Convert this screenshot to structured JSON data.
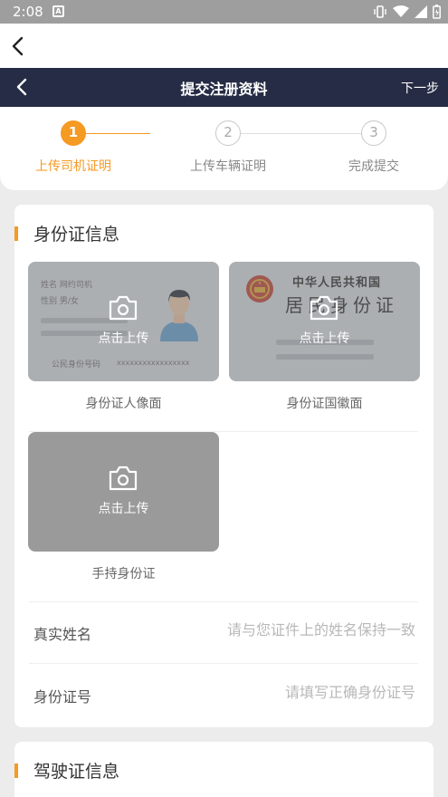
{
  "status_bar": {
    "time": "2:08",
    "notification_badge": "A"
  },
  "header": {
    "title": "提交注册资料",
    "next_label": "下一步"
  },
  "steps": [
    {
      "number": "1",
      "label": "上传司机证明"
    },
    {
      "number": "2",
      "label": "上传车辆证明"
    },
    {
      "number": "3",
      "label": "完成提交"
    }
  ],
  "id_section": {
    "title": "身份证信息",
    "upload_label": "点击上传",
    "front": {
      "caption": "身份证人像面",
      "name_line": "姓名  网约司机",
      "gender_line": "性别  男/女",
      "id_line": "公民身份号码",
      "id_mask": "xxxxxxxxxxxxxxxxx"
    },
    "back": {
      "caption": "身份证国徽面",
      "country": "中华人民共和国",
      "card_name": "居民身份证"
    },
    "hold": {
      "caption": "手持身份证"
    },
    "name_field": {
      "label": "真实姓名",
      "value": "",
      "placeholder": "请与您证件上的姓名保持一致"
    },
    "id_field": {
      "label": "身份证号",
      "value": "",
      "placeholder": "请填写正确身份证号"
    }
  },
  "license_section": {
    "title": "驾驶证信息"
  },
  "colors": {
    "accent": "#f59a23",
    "nav_bg": "#262c45",
    "page_bg": "#ececec"
  }
}
